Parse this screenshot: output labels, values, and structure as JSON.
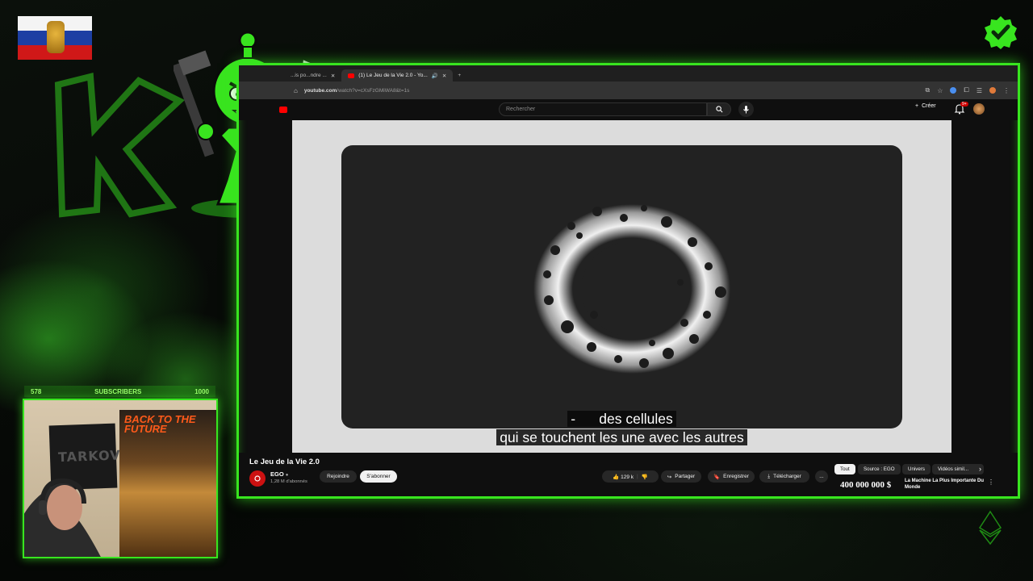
{
  "overlay": {
    "webcam": {
      "subscribers_current": "578",
      "subscribers_label": "SUBSCRIBERS",
      "subscribers_goal": "1000",
      "poster_left_text": "TARKOV",
      "poster_right_text": "BACK TO THE FUTURE"
    }
  },
  "browser": {
    "tabs": [
      {
        "label": "...is po...ndre ...",
        "active": false
      },
      {
        "label": "(1) Le Jeu de la Vie 2.0 - Yo...",
        "active": true
      }
    ],
    "new_tab": "+",
    "url_host": "youtube.com",
    "url_path": "/watch?v=cXsFzGMiWA8&t=1s"
  },
  "youtube": {
    "search_placeholder": "Rechercher",
    "create_label": "Créer",
    "notification_count": "9+",
    "video": {
      "title": "Le Jeu de la Vie 2.0",
      "caption_line1": "-      des cellules",
      "caption_line2": "qui se touchent les une avec les autres"
    },
    "channel": {
      "name": "EGO",
      "subscribers": "1,28 M d'abonnés",
      "join_label": "Rejoindre",
      "subscribe_label": "S'abonner"
    },
    "actions": {
      "likes": "129 k",
      "share": "Partager",
      "save": "Enregistrer",
      "download": "Télécharger",
      "more": "..."
    },
    "chips": [
      "Tout",
      "Source : EGO",
      "Univers",
      "Vidéos simil..."
    ],
    "recommendation": {
      "thumbnail_text": "400 000 000 $",
      "title": "La Machine La Plus Importante Du Monde"
    }
  },
  "colors": {
    "neon_green": "#38e51f",
    "youtube_red": "#ff0000",
    "youtube_bg": "#0f0f0f"
  }
}
